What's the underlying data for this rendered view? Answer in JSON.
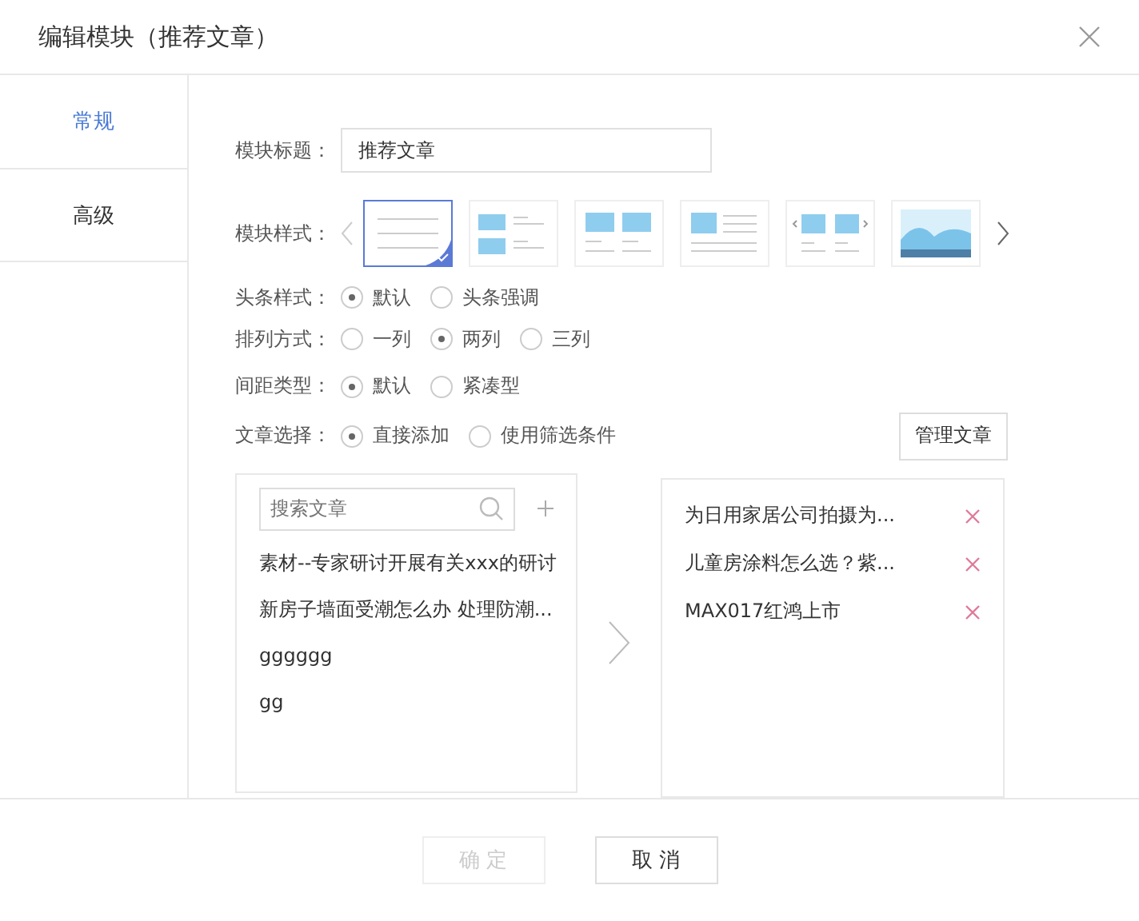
{
  "dialog": {
    "title": "编辑模块（推荐文章）"
  },
  "tabs": [
    {
      "label": "常规",
      "selected": true
    },
    {
      "label": "高级",
      "selected": false
    }
  ],
  "form": {
    "title_label": "模块标题：",
    "title_value": "推荐文章",
    "style_label": "模块样式：",
    "styles": [
      {
        "kind": "list",
        "selected": true
      },
      {
        "kind": "image-list",
        "selected": false
      },
      {
        "kind": "two-col",
        "selected": false
      },
      {
        "kind": "image-text",
        "selected": false
      },
      {
        "kind": "carousel",
        "selected": false
      },
      {
        "kind": "banner",
        "selected": false
      }
    ],
    "radio_groups": [
      {
        "label": "头条样式：",
        "options": [
          {
            "label": "默认",
            "selected": true
          },
          {
            "label": "头条强调",
            "selected": false
          }
        ]
      },
      {
        "label": "排列方式：",
        "options": [
          {
            "label": "一列",
            "selected": false
          },
          {
            "label": "两列",
            "selected": true
          },
          {
            "label": "三列",
            "selected": false
          }
        ]
      },
      {
        "label": "间距类型：",
        "options": [
          {
            "label": "默认",
            "selected": true
          },
          {
            "label": "紧凑型",
            "selected": false
          }
        ]
      },
      {
        "label": "文章选择：",
        "options": [
          {
            "label": "直接添加",
            "selected": true
          },
          {
            "label": "使用筛选条件",
            "selected": false
          }
        ]
      }
    ],
    "manage_button": "管理文章"
  },
  "source_list": {
    "search": {
      "placeholder": "搜索文章"
    },
    "items": [
      "素材--专家研讨开展有关xxx的研讨",
      "新房子墙面受潮怎么办 处理防潮...",
      "gggggg",
      "gg"
    ]
  },
  "selected_list": {
    "items": [
      "为日用家居公司拍摄为...",
      "儿童房涂料怎么选？紫...",
      "MAX017红鸿上市"
    ]
  },
  "buttons": [
    {
      "label": "确 定",
      "disabled": true
    },
    {
      "label": "取 消",
      "disabled": false
    }
  ]
}
